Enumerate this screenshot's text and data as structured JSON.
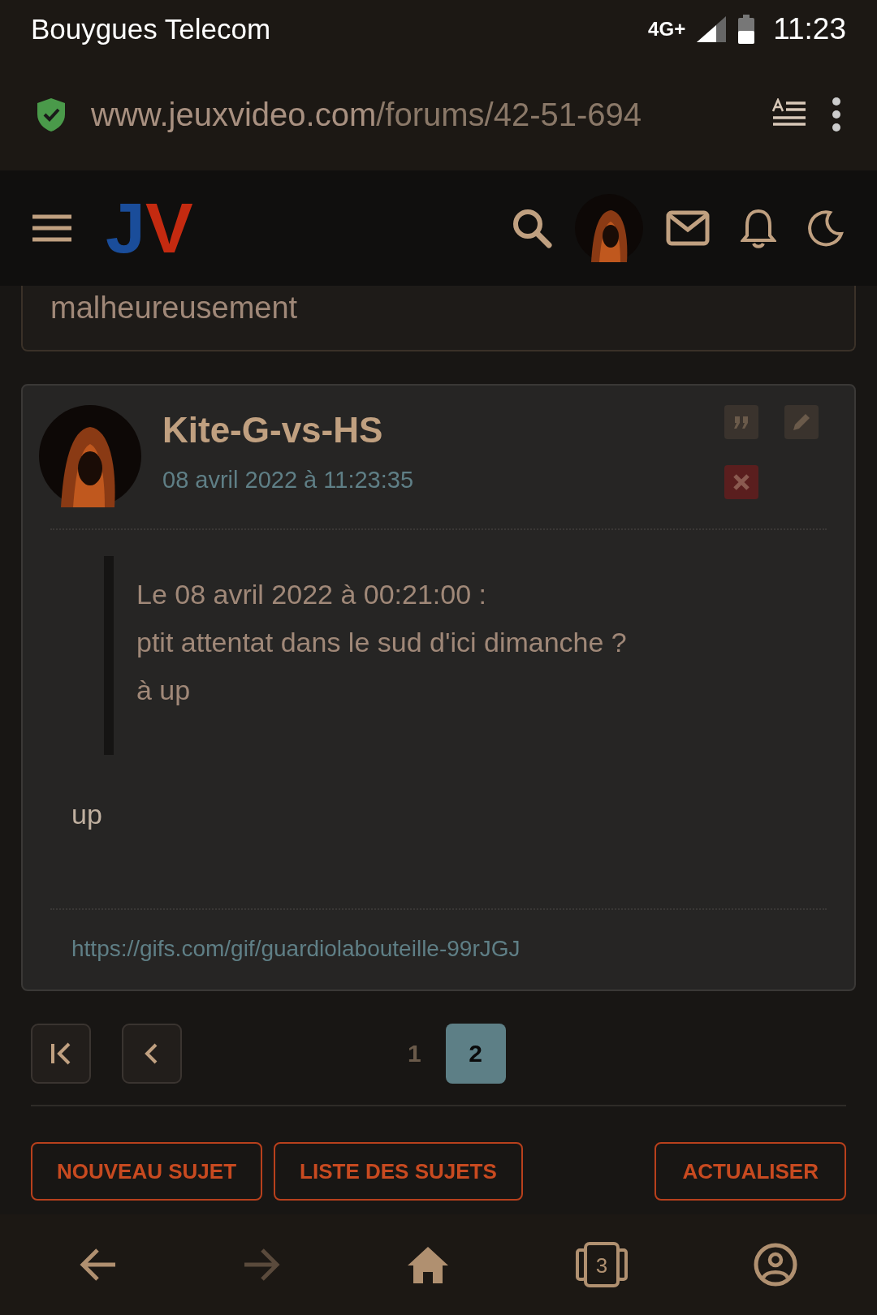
{
  "status_bar": {
    "carrier": "Bouygues Telecom",
    "network": "4G+",
    "time": "11:23"
  },
  "address_bar": {
    "url_host": "www.jeuxvideo.com",
    "url_path": "/forums/42-51-694"
  },
  "site_header": {
    "logo": "JV"
  },
  "previous_post": {
    "text": "malheureusement"
  },
  "post": {
    "author": "Kite-G-vs-HS",
    "date": "08 avril 2022 à 11:23:35",
    "quote": {
      "header": "Le 08 avril 2022 à 00:21:00 :",
      "lines": [
        "ptit attentat dans le sud d'ici dimanche ?",
        "à up"
      ]
    },
    "body": "up",
    "signature": "https://gifs.com/gif/guardiolabouteille-99rJGJ"
  },
  "pagination": {
    "pages": [
      {
        "label": "1",
        "selected": false
      },
      {
        "label": "2",
        "selected": true
      }
    ]
  },
  "actions": [
    {
      "label": "NOUVEAU SUJET"
    },
    {
      "label": "LISTE DES SUJETS"
    },
    {
      "label": "ACTUALISER"
    }
  ],
  "browser_nav": {
    "back_disabled": false,
    "forward_disabled": true,
    "tab_count": "3"
  }
}
